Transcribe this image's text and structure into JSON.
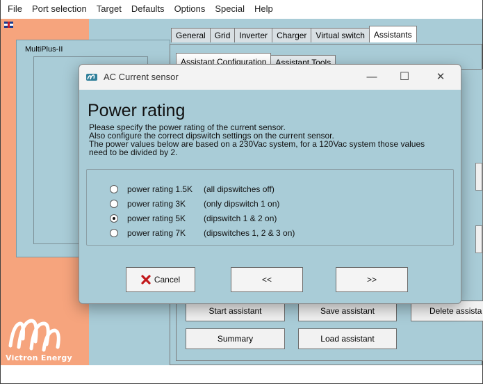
{
  "menu": [
    "File",
    "Port selection",
    "Target",
    "Defaults",
    "Options",
    "Special",
    "Help"
  ],
  "app": {
    "device_label": "MultiPlus-II",
    "brand": "Victron Energy",
    "tabs": [
      "General",
      "Grid",
      "Inverter",
      "Charger",
      "Virtual switch",
      "Assistants"
    ],
    "active_tab": "Assistants",
    "subtabs": [
      "Assistant Configuration",
      "Assistant Tools"
    ],
    "buttons": {
      "start": "Start assistant",
      "save": "Save assistant",
      "delete": "Delete assista",
      "summary": "Summary",
      "load": "Load assistant"
    }
  },
  "dialog": {
    "window_title": "AC Current sensor",
    "heading": "Power rating",
    "description": [
      "Please specify the power rating of the current sensor.",
      "Also configure the correct dipswitch settings on the current sensor.",
      "The power values below are based on a 230Vac system, for a 120Vac system those values",
      "need to be divided by 2."
    ],
    "options": [
      {
        "label": "power rating 1.5K",
        "hint": "(all dipswitches off)",
        "checked": false
      },
      {
        "label": "power rating 3K",
        "hint": "(only dipswitch 1 on)",
        "checked": false
      },
      {
        "label": "power rating 5K",
        "hint": "(dipswitch 1 & 2 on)",
        "checked": true
      },
      {
        "label": "power rating 7K",
        "hint": "(dipswitches 1, 2 & 3 on)",
        "checked": false
      }
    ],
    "buttons": {
      "cancel": "Cancel",
      "back": "<<",
      "next": ">>"
    },
    "controls": {
      "minimize": "—",
      "maximize": "☐",
      "close": "✕"
    }
  },
  "colors": {
    "app_bg": "#a9ccd7",
    "side_orange": "#f6a47d",
    "cancel_icon": "#c2181b"
  }
}
